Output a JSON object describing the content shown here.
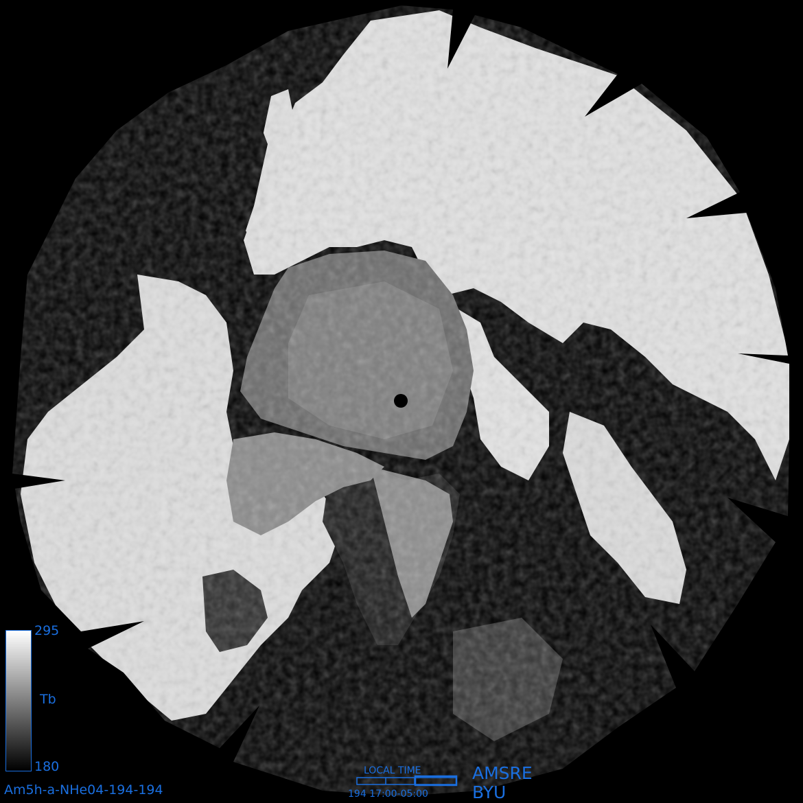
{
  "product_id": "Am5h-a-NHe04-194-194",
  "sensor": "AMSRE",
  "institution": "BYU",
  "colorbar": {
    "max_label": "295",
    "min_label": "180",
    "quantity_label": "Tb",
    "max": 295,
    "min": 180
  },
  "local_time": {
    "title": "LOCAL TIME",
    "range_label": "194 17:00-05:00"
  },
  "colors": {
    "accent": "#1a6fe0",
    "background": "#000000",
    "land": "#e4e4e4",
    "sea_ice": "#6e6e6e",
    "ocean": "#000000"
  },
  "projection": "polar stereographic, north polar view",
  "grid": false
}
